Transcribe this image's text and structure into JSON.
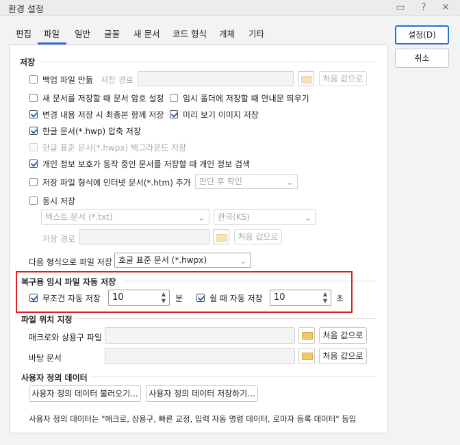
{
  "window": {
    "title": "환경 설정"
  },
  "titlebar_icons": [
    "comment-icon",
    "help-icon",
    "close-icon"
  ],
  "titlebar_glyphs": {
    "comment": "▭",
    "help": "?",
    "close": "✕"
  },
  "tabs": [
    {
      "label": "편집"
    },
    {
      "label": "파일"
    },
    {
      "label": "일반"
    },
    {
      "label": "글꼴"
    },
    {
      "label": "새 문서"
    },
    {
      "label": "코드 형식"
    },
    {
      "label": "개체"
    },
    {
      "label": "기타"
    }
  ],
  "active_tab": "파일",
  "buttons": {
    "ok": "설정(D)",
    "cancel": "취소"
  },
  "save": {
    "title": "저장",
    "backup": {
      "label": "백업 파일 만듦",
      "checked": false,
      "path_label": "저장 경로",
      "reset": "처음 값으로"
    },
    "password_new": {
      "label": "새 문서를 저장할 때 문서 암호 설정",
      "checked": false
    },
    "temp_notice": {
      "label": "임시 폴더에 저장할 때 안내문 띄우기",
      "checked": false
    },
    "final_save": {
      "label": "변경 내용 저장 시 최종본 함께 저장",
      "checked": true
    },
    "preview_img": {
      "label": "미리 보기 이미지 저장",
      "checked": true
    },
    "compress": {
      "label": "한글 문서(*.hwp) 압축 저장",
      "checked": true
    },
    "hwpx_bg": {
      "label": "한글 표준 문서(*.hwpx) 백그라운드 저장",
      "checked": false,
      "disabled": true
    },
    "privacy": {
      "label": "개인 정보 보호가 동작 중인 문서를 저장할 때 개인 정보 검색",
      "checked": true
    },
    "internet": {
      "label": "저장 파일 형식에 인터넷 문서(*.htm) 추가",
      "checked": false,
      "select": "판단 후 확인"
    },
    "simul": {
      "label": "동시 저장",
      "checked": false,
      "format": "텍스트 문서 (*.txt)",
      "encoding": "한국(KS)",
      "path_label": "저장 경로",
      "reset": "처음 값으로"
    },
    "format_label": "다음 형식으로 파일 저장",
    "format_value": "호글 표준 문서 (*.hwpx)"
  },
  "autosave": {
    "title": "복구용 임시 파일 자동 저장",
    "always": {
      "label": "무조건 자동 저장",
      "checked": true,
      "value": "10",
      "unit": "분"
    },
    "idle": {
      "label": "쉴 때 자동 저장",
      "checked": true,
      "value": "10",
      "unit": "초"
    }
  },
  "location": {
    "title": "파일 위치 지정",
    "macro": {
      "label": "매크로와 상용구 파일",
      "reset": "처음 값으로"
    },
    "background": {
      "label": "바탕 문서",
      "reset": "처음 값으로"
    }
  },
  "userdata": {
    "title": "사용자 정의 데이터",
    "load": "사용자 정의 데이터 불러오기...",
    "save": "사용자 정의 데이터 저장하기...",
    "note": "사용자 정의 데이터는 \"매크로, 상용구, 빠른 교정, 입력 자동 명령 데이터, 로마자 등록 데이터\" 등입"
  },
  "colors": {
    "accent": "#2a6fd6",
    "highlight": "#e01e1e",
    "check": "#2b5fbf"
  }
}
